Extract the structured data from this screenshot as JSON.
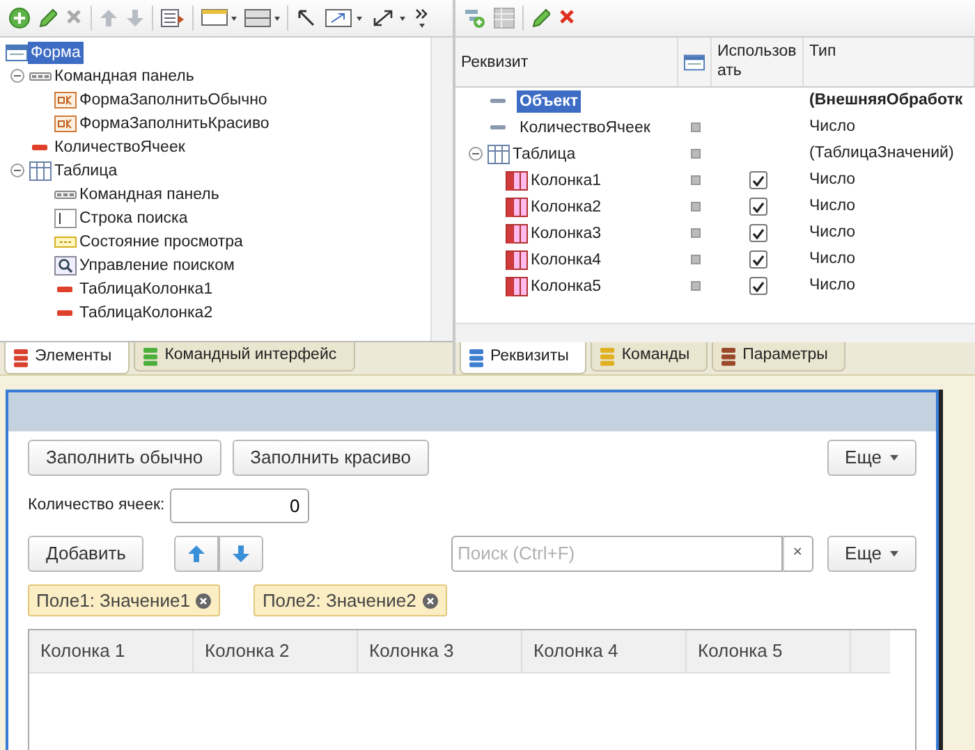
{
  "elements_panel": {
    "tree": [
      {
        "label": "Форма",
        "kind": "form",
        "selected": true
      },
      {
        "label": "Командная панель",
        "kind": "cmdbar",
        "selected": false,
        "expanded": true,
        "children": [
          {
            "label": "ФормаЗаполнитьОбычно",
            "kind": "button",
            "selected": false
          },
          {
            "label": "ФормаЗаполнитьКрасиво",
            "kind": "button",
            "selected": false
          }
        ]
      },
      {
        "label": "КоличествоЯчеек",
        "kind": "field",
        "selected": false
      },
      {
        "label": "Таблица",
        "kind": "table",
        "selected": false,
        "expanded": true,
        "children": [
          {
            "label": "Командная панель",
            "kind": "cmdbar",
            "selected": false
          },
          {
            "label": "Строка поиска",
            "kind": "searchline",
            "selected": false
          },
          {
            "label": "Состояние просмотра",
            "kind": "viewstate",
            "selected": false
          },
          {
            "label": "Управление поиском",
            "kind": "searchctl",
            "selected": false
          },
          {
            "label": "ТаблицаКолонка1",
            "kind": "field",
            "selected": false
          },
          {
            "label": "ТаблицаКолонка2",
            "kind": "field",
            "selected": false
          }
        ]
      }
    ],
    "tabs": [
      {
        "label": "Элементы",
        "selected": true,
        "color": "#d9412f"
      },
      {
        "label": "Командный интерфейс",
        "selected": false,
        "color": "#4caf3c"
      }
    ]
  },
  "attributes_panel": {
    "columns": [
      "Реквизит",
      "Использовать",
      "Тип"
    ],
    "rows": [
      {
        "name": "Объект",
        "type": "(ВнешняяОбработк",
        "kind": "main",
        "selected": true
      },
      {
        "name": "КоличествоЯчеек",
        "type": "Число",
        "kind": "attr",
        "selected": false
      },
      {
        "name": "Таблица",
        "type": "(ТаблицаЗначений)",
        "kind": "table",
        "selected": false,
        "expanded": true,
        "children": [
          {
            "name": "Колонка1",
            "type": "Число",
            "checked": true,
            "selected": false
          },
          {
            "name": "Колонка2",
            "type": "Число",
            "checked": true,
            "selected": false
          },
          {
            "name": "Колонка3",
            "type": "Число",
            "checked": true,
            "selected": false
          },
          {
            "name": "Колонка4",
            "type": "Число",
            "checked": true,
            "selected": false
          },
          {
            "name": "Колонка5",
            "type": "Число",
            "checked": true,
            "selected": false
          }
        ]
      }
    ],
    "tabs": [
      {
        "label": "Реквизиты",
        "selected": true,
        "color": "#3f7fd0"
      },
      {
        "label": "Команды",
        "selected": false,
        "color": "#e0b020"
      },
      {
        "label": "Параметры",
        "selected": false,
        "color": "#9a4a2a"
      }
    ]
  },
  "form_preview": {
    "command_bar": {
      "buttons": [
        "Заполнить обычно",
        "Заполнить красиво"
      ],
      "more": "Еще"
    },
    "cells_field": {
      "label": "Количество ячеек:",
      "value": "0"
    },
    "table_bar": {
      "add": "Добавить",
      "search": {
        "placeholder": "Поиск (Ctrl+F)",
        "clear": "×"
      },
      "more": "Еще"
    },
    "filters": [
      "Поле1: Значение1",
      "Поле2: Значение2"
    ],
    "table": {
      "columns": [
        "Колонка 1",
        "Колонка 2",
        "Колонка 3",
        "Колонка 4",
        "Колонка 5"
      ]
    }
  }
}
